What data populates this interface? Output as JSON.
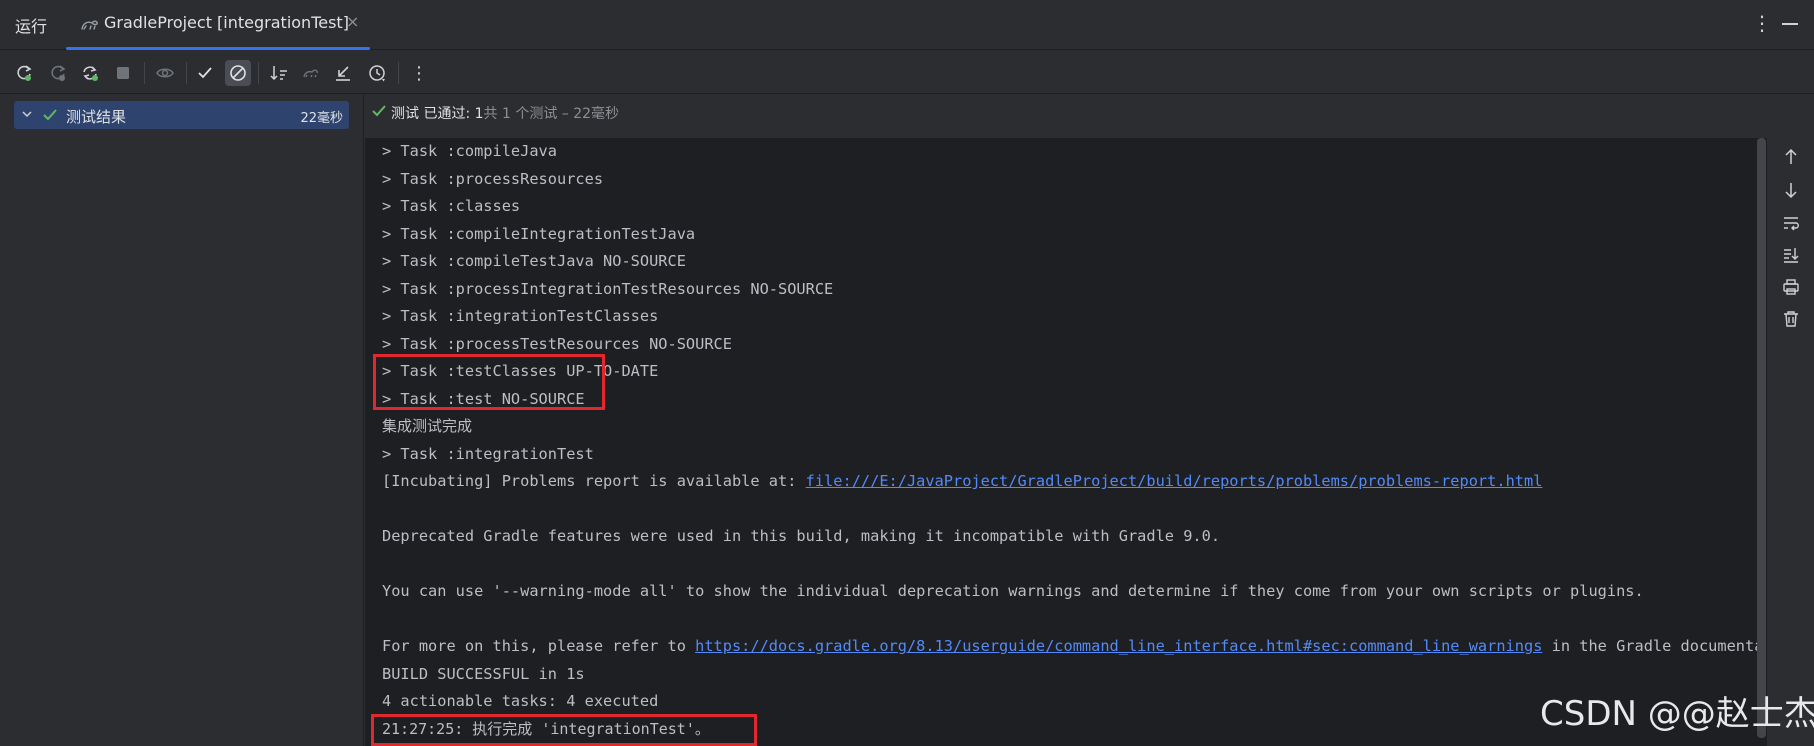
{
  "run_panel": {
    "title": "运行",
    "tab": {
      "title": "GradleProject [integrationTest]",
      "close_glyph": "×"
    },
    "more_glyph": "⋮"
  },
  "toolbar": {
    "buttons": [
      "rerun-icon",
      "rerun-failed-icon",
      "toggle-auto-test-icon",
      "stop-icon",
      "show-ignored-icon",
      "show-passed-icon",
      "show-ignored-toggle-icon",
      "sort-icon",
      "import-tests-icon",
      "collapse-icon",
      "history-icon",
      "more-icon"
    ],
    "more_glyph": "⋮"
  },
  "test_tree": {
    "root_label": "测试结果",
    "root_time": "22毫秒"
  },
  "status_bar": {
    "prefix": "测试 已通过: 1",
    "suffix": "共 1 个测试 – 22毫秒"
  },
  "console": {
    "lines": [
      "> Task :compileJava",
      "> Task :processResources",
      "> Task :classes",
      "> Task :compileIntegrationTestJava",
      "> Task :compileTestJava NO-SOURCE",
      "> Task :processIntegrationTestResources NO-SOURCE",
      "> Task :integrationTestClasses",
      "> Task :processTestResources NO-SOURCE",
      "> Task :testClasses UP-TO-DATE",
      "> Task :test NO-SOURCE",
      "集成测试完成",
      "> Task :integrationTest"
    ],
    "problems_prefix": "[Incubating] Problems report is available at: ",
    "problems_link": "file:///E:/JavaProject/GradleProject/build/reports/problems/problems-report.html",
    "deprecated": "Deprecated Gradle features were used in this build, making it incompatible with Gradle 9.0.",
    "warning_mode": "You can use '--warning-mode all' to show the individual deprecation warnings and determine if they come from your own scripts or plugins.",
    "refer_prefix": "For more on this, please refer to ",
    "refer_link": "https://docs.gradle.org/8.13/userguide/command_line_interface.html#sec:command_line_warnings",
    "refer_suffix": " in the Gradle documentation.",
    "build_result": "BUILD SUCCESSFUL in 1s",
    "tasks_summary": "4 actionable tasks: 4 executed",
    "finished": "21:27:25: 执行完成 'integrationTest'。"
  },
  "right_toolbar": [
    "up-arrow-icon",
    "down-arrow-icon",
    "soft-wrap-icon",
    "scroll-to-end-icon",
    "print-icon",
    "clear-all-icon"
  ],
  "watermark": "CSDN @@赵士杰",
  "colors": {
    "accent": "#3574f0",
    "pass_green": "#5fb865",
    "highlight_red": "#e0282e",
    "link": "#548af7",
    "console_bg": "#1e1f22",
    "panel_bg": "#2b2d30"
  }
}
